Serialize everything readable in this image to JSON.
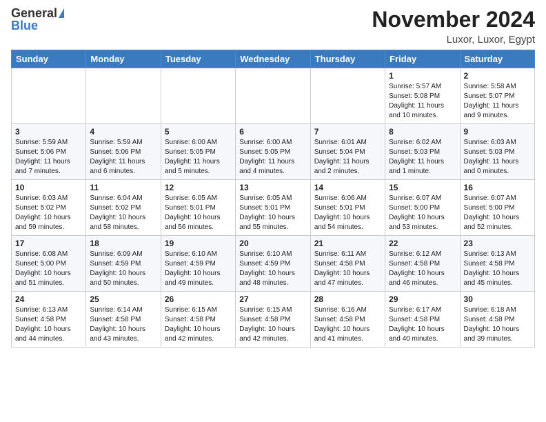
{
  "header": {
    "logo_general": "General",
    "logo_blue": "Blue",
    "title": "November 2024",
    "location": "Luxor, Luxor, Egypt"
  },
  "weekdays": [
    "Sunday",
    "Monday",
    "Tuesday",
    "Wednesday",
    "Thursday",
    "Friday",
    "Saturday"
  ],
  "weeks": [
    [
      {
        "day": "",
        "info": ""
      },
      {
        "day": "",
        "info": ""
      },
      {
        "day": "",
        "info": ""
      },
      {
        "day": "",
        "info": ""
      },
      {
        "day": "",
        "info": ""
      },
      {
        "day": "1",
        "info": "Sunrise: 5:57 AM\nSunset: 5:08 PM\nDaylight: 11 hours\nand 10 minutes."
      },
      {
        "day": "2",
        "info": "Sunrise: 5:58 AM\nSunset: 5:07 PM\nDaylight: 11 hours\nand 9 minutes."
      }
    ],
    [
      {
        "day": "3",
        "info": "Sunrise: 5:59 AM\nSunset: 5:06 PM\nDaylight: 11 hours\nand 7 minutes."
      },
      {
        "day": "4",
        "info": "Sunrise: 5:59 AM\nSunset: 5:06 PM\nDaylight: 11 hours\nand 6 minutes."
      },
      {
        "day": "5",
        "info": "Sunrise: 6:00 AM\nSunset: 5:05 PM\nDaylight: 11 hours\nand 5 minutes."
      },
      {
        "day": "6",
        "info": "Sunrise: 6:00 AM\nSunset: 5:05 PM\nDaylight: 11 hours\nand 4 minutes."
      },
      {
        "day": "7",
        "info": "Sunrise: 6:01 AM\nSunset: 5:04 PM\nDaylight: 11 hours\nand 2 minutes."
      },
      {
        "day": "8",
        "info": "Sunrise: 6:02 AM\nSunset: 5:03 PM\nDaylight: 11 hours\nand 1 minute."
      },
      {
        "day": "9",
        "info": "Sunrise: 6:03 AM\nSunset: 5:03 PM\nDaylight: 11 hours\nand 0 minutes."
      }
    ],
    [
      {
        "day": "10",
        "info": "Sunrise: 6:03 AM\nSunset: 5:02 PM\nDaylight: 10 hours\nand 59 minutes."
      },
      {
        "day": "11",
        "info": "Sunrise: 6:04 AM\nSunset: 5:02 PM\nDaylight: 10 hours\nand 58 minutes."
      },
      {
        "day": "12",
        "info": "Sunrise: 6:05 AM\nSunset: 5:01 PM\nDaylight: 10 hours\nand 56 minutes."
      },
      {
        "day": "13",
        "info": "Sunrise: 6:05 AM\nSunset: 5:01 PM\nDaylight: 10 hours\nand 55 minutes."
      },
      {
        "day": "14",
        "info": "Sunrise: 6:06 AM\nSunset: 5:01 PM\nDaylight: 10 hours\nand 54 minutes."
      },
      {
        "day": "15",
        "info": "Sunrise: 6:07 AM\nSunset: 5:00 PM\nDaylight: 10 hours\nand 53 minutes."
      },
      {
        "day": "16",
        "info": "Sunrise: 6:07 AM\nSunset: 5:00 PM\nDaylight: 10 hours\nand 52 minutes."
      }
    ],
    [
      {
        "day": "17",
        "info": "Sunrise: 6:08 AM\nSunset: 5:00 PM\nDaylight: 10 hours\nand 51 minutes."
      },
      {
        "day": "18",
        "info": "Sunrise: 6:09 AM\nSunset: 4:59 PM\nDaylight: 10 hours\nand 50 minutes."
      },
      {
        "day": "19",
        "info": "Sunrise: 6:10 AM\nSunset: 4:59 PM\nDaylight: 10 hours\nand 49 minutes."
      },
      {
        "day": "20",
        "info": "Sunrise: 6:10 AM\nSunset: 4:59 PM\nDaylight: 10 hours\nand 48 minutes."
      },
      {
        "day": "21",
        "info": "Sunrise: 6:11 AM\nSunset: 4:58 PM\nDaylight: 10 hours\nand 47 minutes."
      },
      {
        "day": "22",
        "info": "Sunrise: 6:12 AM\nSunset: 4:58 PM\nDaylight: 10 hours\nand 46 minutes."
      },
      {
        "day": "23",
        "info": "Sunrise: 6:13 AM\nSunset: 4:58 PM\nDaylight: 10 hours\nand 45 minutes."
      }
    ],
    [
      {
        "day": "24",
        "info": "Sunrise: 6:13 AM\nSunset: 4:58 PM\nDaylight: 10 hours\nand 44 minutes."
      },
      {
        "day": "25",
        "info": "Sunrise: 6:14 AM\nSunset: 4:58 PM\nDaylight: 10 hours\nand 43 minutes."
      },
      {
        "day": "26",
        "info": "Sunrise: 6:15 AM\nSunset: 4:58 PM\nDaylight: 10 hours\nand 42 minutes."
      },
      {
        "day": "27",
        "info": "Sunrise: 6:15 AM\nSunset: 4:58 PM\nDaylight: 10 hours\nand 42 minutes."
      },
      {
        "day": "28",
        "info": "Sunrise: 6:16 AM\nSunset: 4:58 PM\nDaylight: 10 hours\nand 41 minutes."
      },
      {
        "day": "29",
        "info": "Sunrise: 6:17 AM\nSunset: 4:58 PM\nDaylight: 10 hours\nand 40 minutes."
      },
      {
        "day": "30",
        "info": "Sunrise: 6:18 AM\nSunset: 4:58 PM\nDaylight: 10 hours\nand 39 minutes."
      }
    ]
  ]
}
